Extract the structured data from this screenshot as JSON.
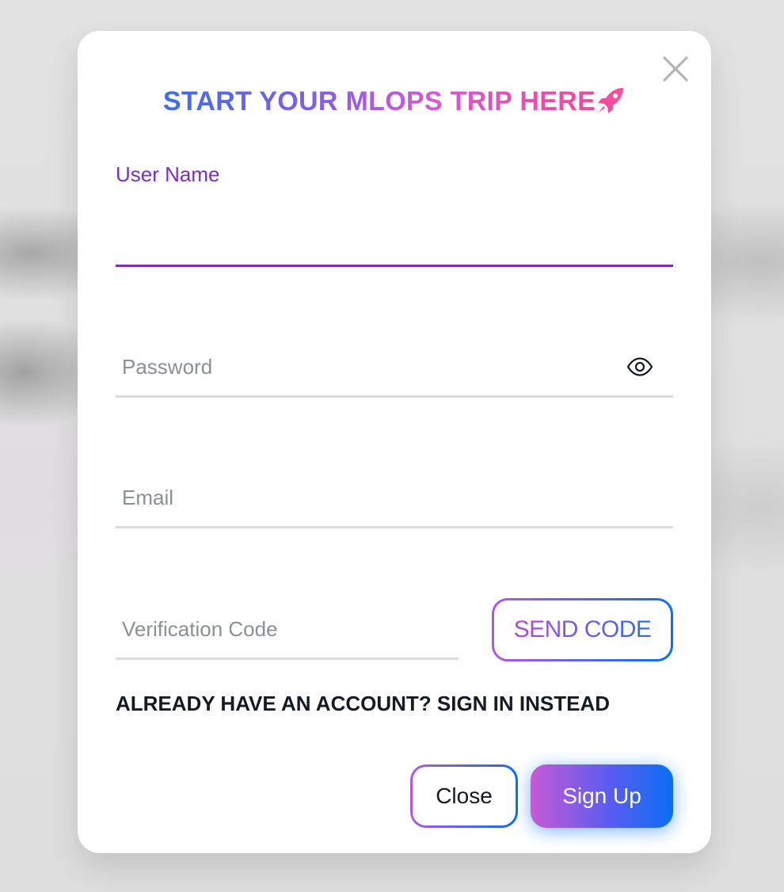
{
  "dialog": {
    "title": "START YOUR MLOPS TRIP HERE",
    "title_icon": "rocket-icon",
    "close_icon": "close-icon"
  },
  "fields": {
    "username": {
      "label": "User Name",
      "value": "",
      "placeholder": ""
    },
    "password": {
      "label": "",
      "value": "",
      "placeholder": "Password",
      "toggle_icon": "eye-icon"
    },
    "email": {
      "label": "",
      "value": "",
      "placeholder": "Email"
    },
    "verification_code": {
      "label": "",
      "value": "",
      "placeholder": "Verification Code"
    }
  },
  "buttons": {
    "send_code": "SEND CODE",
    "close": "Close",
    "sign_up": "Sign Up"
  },
  "links": {
    "sign_in_instead": "ALREADY HAVE AN ACCOUNT? SIGN IN INSTEAD"
  },
  "colors": {
    "accent_purple": "#7b2fbe",
    "brand_blue": "#0a6ff0",
    "brand_pink": "#f2489e",
    "input_underline": "#dcdcdc"
  }
}
